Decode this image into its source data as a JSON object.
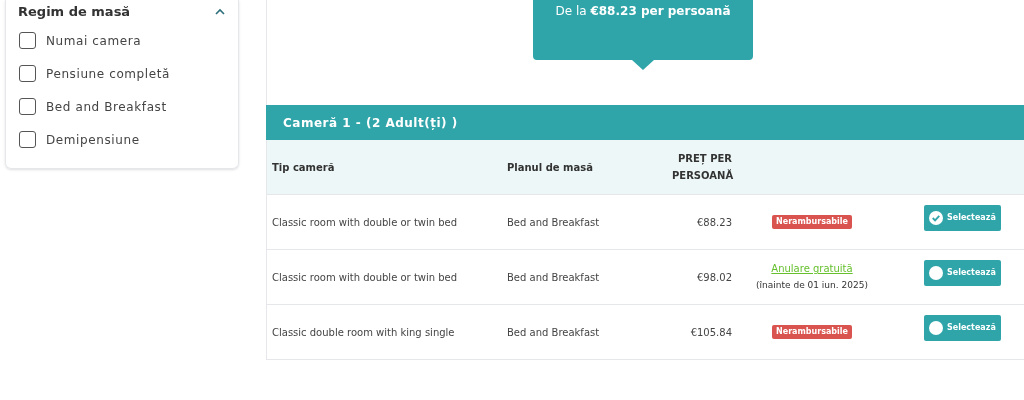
{
  "filter": {
    "title": "Regim de masă",
    "expanded": true,
    "options": [
      {
        "label": "Numai camera",
        "checked": false
      },
      {
        "label": "Pensiune completă",
        "checked": false
      },
      {
        "label": "Bed and Breakfast",
        "checked": false
      },
      {
        "label": "Demipensiune",
        "checked": false
      }
    ]
  },
  "price_callout": "De la **€88.23 per persoană**",
  "room": {
    "title": "Cameră 1 - (2 Adult(ți) )",
    "columns": [
      "Tip cameră",
      "Planul de masă",
      "PREȚ PER PERSOANĂ"
    ],
    "rows": [
      {
        "room_type": "Classic room with double or twin bed",
        "meal_plan": "Bed and Breakfast",
        "price": "€88.23",
        "policy": {
          "kind": "nonrefundable",
          "label": "Nerambursabile"
        },
        "button": "Selectează",
        "selected": true
      },
      {
        "room_type": "Classic room with double or twin bed",
        "meal_plan": "Bed and Breakfast",
        "price": "€98.02",
        "policy": {
          "kind": "free_cancellation",
          "label": "Anulare gratuită",
          "note": "(înainte de 01 iun. 2025)"
        },
        "button": "Selectează",
        "selected": false
      },
      {
        "room_type": "Classic double room with king single",
        "meal_plan": "Bed and Breakfast",
        "price": "€105.84",
        "policy": {
          "kind": "nonrefundable",
          "label": "Nerambursabile"
        },
        "button": "Selectează",
        "selected": false
      }
    ]
  }
}
